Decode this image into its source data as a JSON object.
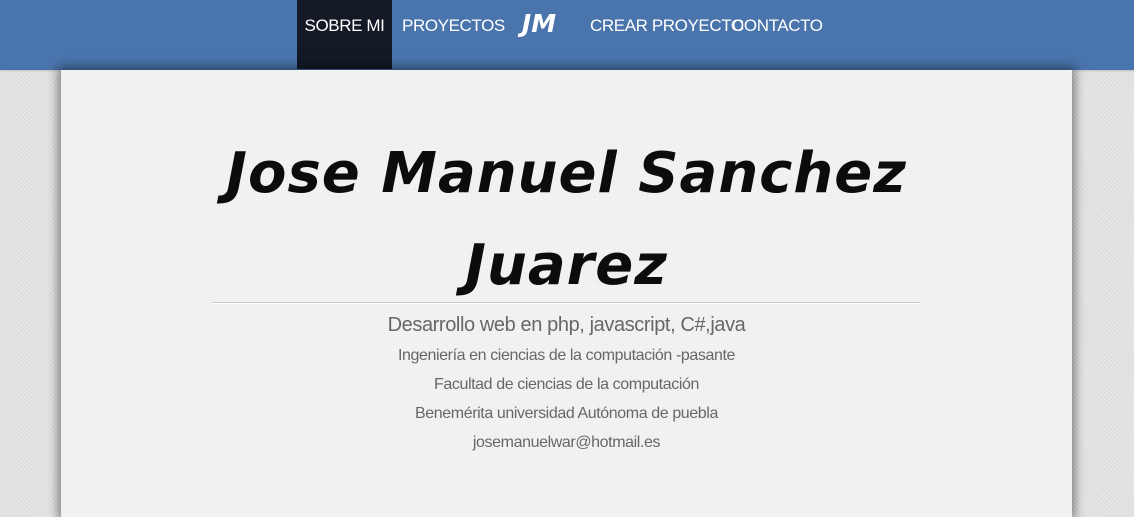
{
  "nav": {
    "items": [
      {
        "label": "SOBRE MI",
        "active": true
      },
      {
        "label": "PROYECTOS",
        "active": false
      },
      {
        "label": "CREAR PROYECTO",
        "active": false
      },
      {
        "label": "CONTACTO",
        "active": false
      }
    ],
    "logo_text": "JM"
  },
  "profile": {
    "name_line1": "Jose Manuel Sanchez",
    "name_line2": "Juarez",
    "headline": "Desarrollo web en php, javascript, C#,java",
    "details": [
      "Ingeniería en ciencias de la computación -pasante",
      "Facultad de ciencias de la computación",
      "Benemérita universidad Autónoma de puebla",
      "josemanuelwar@hotmail.es"
    ]
  },
  "colors": {
    "navbar": "#4a74ac",
    "nav_active": "#131a26",
    "card_bg": "#f4f4f4",
    "name_text": "#0c0c0c",
    "info_text": "#676767"
  }
}
